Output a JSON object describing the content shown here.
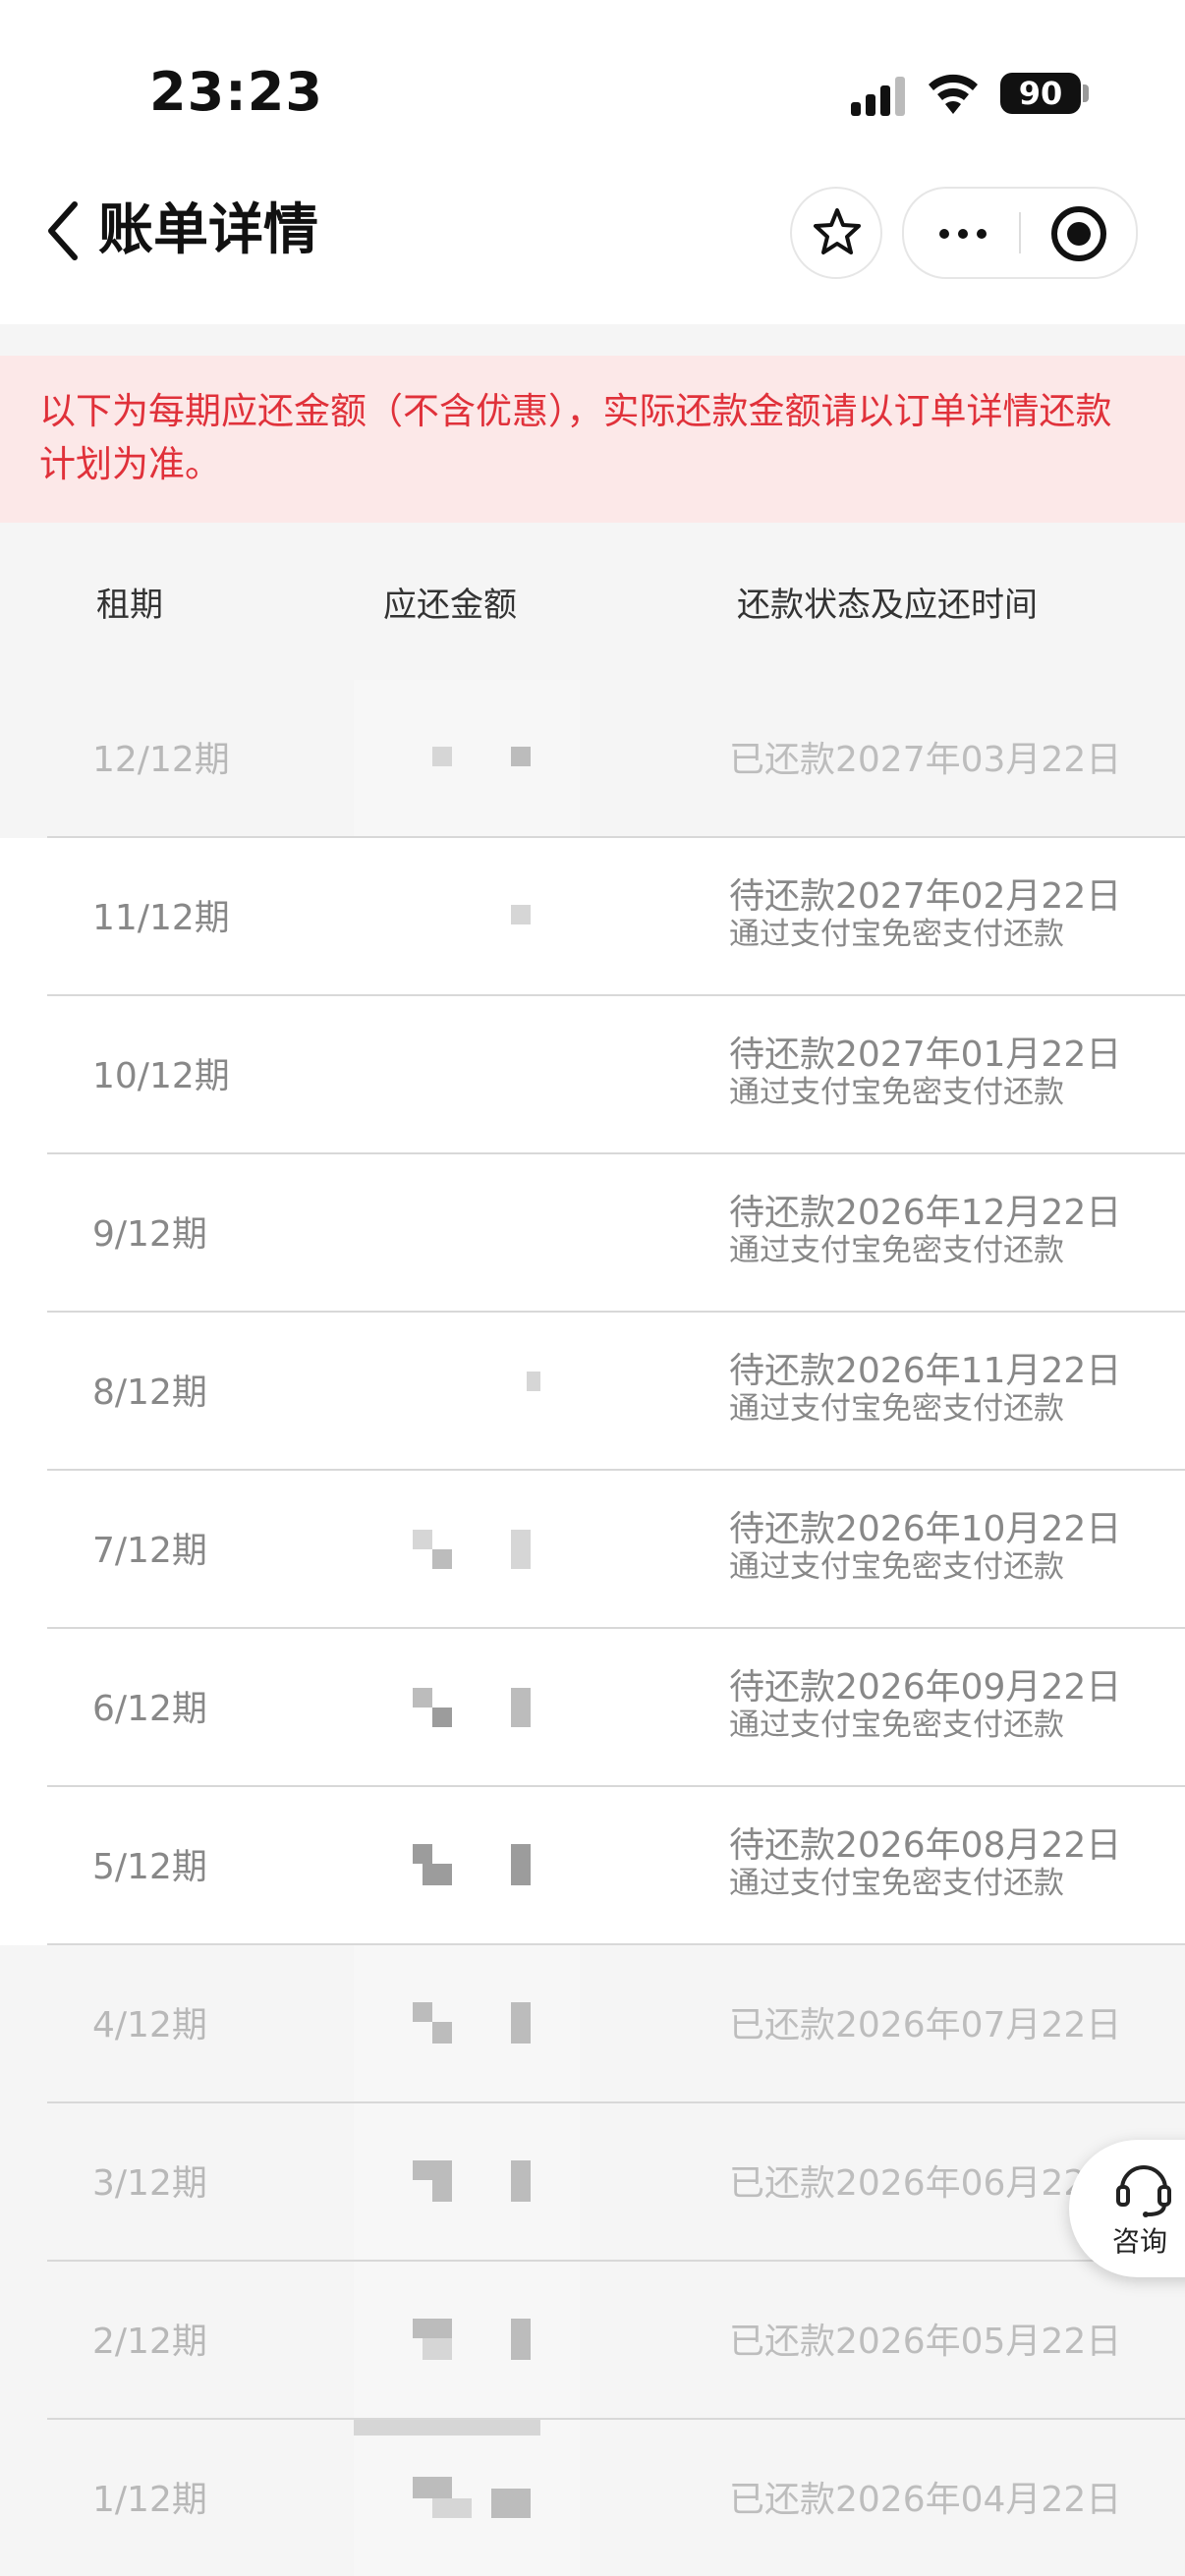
{
  "status_bar": {
    "time": "23:23",
    "battery": "90"
  },
  "nav": {
    "title": "账单详情"
  },
  "notice": {
    "text": "以下为每期应还金额（不含优惠），实际还款金额请以订单详情还款计划为准。",
    "color": "#e0313a",
    "background": "#fce8e8"
  },
  "table": {
    "headers": {
      "term": "租期",
      "amount": "应还金额",
      "status": "还款状态及应还时间"
    },
    "rows": [
      {
        "term": "12/12期",
        "status": "已还款2027年03月22日",
        "sub": "",
        "paid": true
      },
      {
        "term": "11/12期",
        "status": "待还款2027年02月22日",
        "sub": "通过支付宝免密支付还款",
        "paid": false
      },
      {
        "term": "10/12期",
        "status": "待还款2027年01月22日",
        "sub": "通过支付宝免密支付还款",
        "paid": false
      },
      {
        "term": "9/12期",
        "status": "待还款2026年12月22日",
        "sub": "通过支付宝免密支付还款",
        "paid": false
      },
      {
        "term": "8/12期",
        "status": "待还款2026年11月22日",
        "sub": "通过支付宝免密支付还款",
        "paid": false
      },
      {
        "term": "7/12期",
        "status": "待还款2026年10月22日",
        "sub": "通过支付宝免密支付还款",
        "paid": false
      },
      {
        "term": "6/12期",
        "status": "待还款2026年09月22日",
        "sub": "通过支付宝免密支付还款",
        "paid": false
      },
      {
        "term": "5/12期",
        "status": "待还款2026年08月22日",
        "sub": "通过支付宝免密支付还款",
        "paid": false
      },
      {
        "term": "4/12期",
        "status": "已还款2026年07月22日",
        "sub": "",
        "paid": true
      },
      {
        "term": "3/12期",
        "status": "已还款2026年06月22日",
        "sub": "",
        "paid": true
      },
      {
        "term": "2/12期",
        "status": "已还款2026年05月22日",
        "sub": "",
        "paid": true
      },
      {
        "term": "1/12期",
        "status": "已还款2026年04月22日",
        "sub": "",
        "paid": true
      }
    ]
  },
  "consult": {
    "label": "咨询"
  },
  "icons": {
    "back": "chevron-left-icon",
    "favorite": "star-icon",
    "more": "more-dots-icon",
    "close": "target-close-icon",
    "consult": "headset-icon"
  }
}
